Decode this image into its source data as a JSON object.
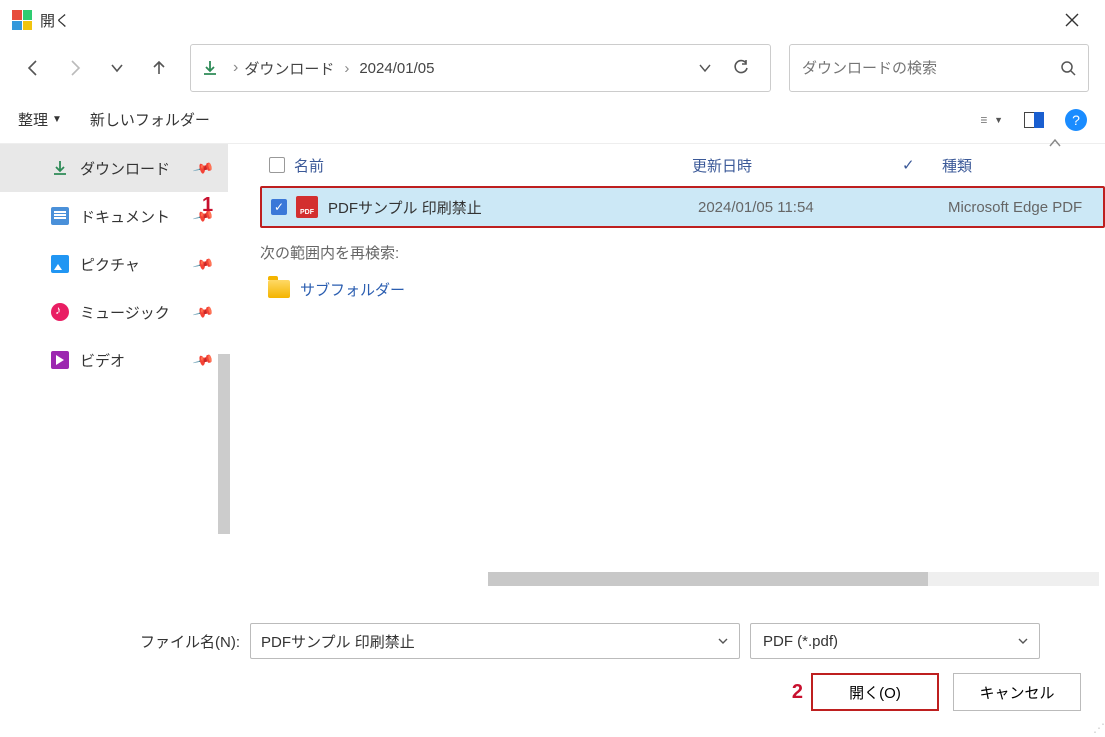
{
  "window": {
    "title": "開く"
  },
  "nav": {},
  "breadcrumb": {
    "items": [
      "ダウンロード",
      "2024/01/05"
    ]
  },
  "search": {
    "placeholder": "ダウンロードの検索"
  },
  "toolbar": {
    "organize": "整理",
    "new_folder": "新しいフォルダー"
  },
  "sidebar": {
    "items": [
      {
        "label": "ダウンロード"
      },
      {
        "label": "ドキュメント"
      },
      {
        "label": "ピクチャ"
      },
      {
        "label": "ミュージック"
      },
      {
        "label": "ビデオ"
      }
    ]
  },
  "columns": {
    "name": "名前",
    "date": "更新日時",
    "type": "種類"
  },
  "files": [
    {
      "name": "PDFサンプル 印刷禁止",
      "date": "2024/01/05 11:54",
      "type": "Microsoft Edge PDF"
    }
  ],
  "research": {
    "label": "次の範囲内を再検索:",
    "subfolder": "サブフォルダー"
  },
  "bottom": {
    "filename_label": "ファイル名(N):",
    "filename_value": "PDFサンプル 印刷禁止",
    "filter": "PDF (*.pdf)",
    "open": "開く(O)",
    "cancel": "キャンセル"
  },
  "annotations": {
    "one": "1",
    "two": "2"
  }
}
